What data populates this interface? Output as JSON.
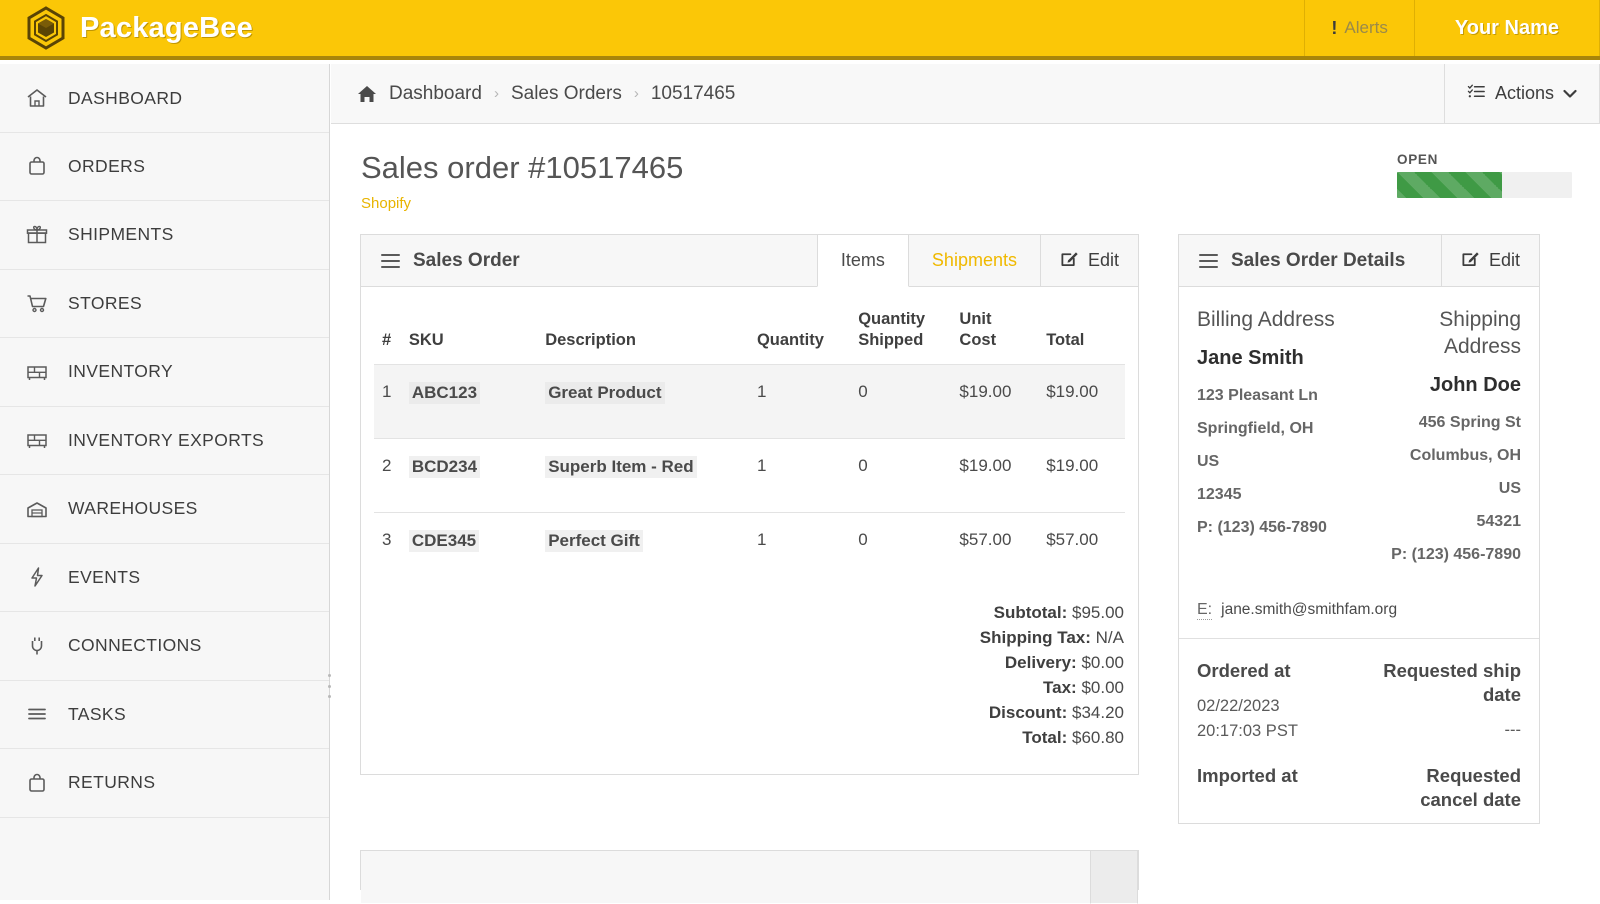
{
  "topbar": {
    "brand": "PackageBee",
    "logo_icon": "hexagon-cube-logo",
    "alerts_label": "Alerts",
    "alerts_icon": "exclamation-icon",
    "user_label": "Your Name"
  },
  "sidebar": {
    "items": [
      {
        "label": "DASHBOARD",
        "icon": "home-icon"
      },
      {
        "label": "ORDERS",
        "icon": "bag-icon"
      },
      {
        "label": "SHIPMENTS",
        "icon": "gift-icon"
      },
      {
        "label": "STORES",
        "icon": "shopping-cart-icon"
      },
      {
        "label": "INVENTORY",
        "icon": "shelf-icon"
      },
      {
        "label": "INVENTORY EXPORTS",
        "icon": "shelf-icon"
      },
      {
        "label": "WAREHOUSES",
        "icon": "warehouse-icon"
      },
      {
        "label": "EVENTS",
        "icon": "lightning-bolt-icon"
      },
      {
        "label": "CONNECTIONS",
        "icon": "plug-icon"
      },
      {
        "label": "TASKS",
        "icon": "list-icon"
      },
      {
        "label": "RETURNS",
        "icon": "bag-icon"
      }
    ]
  },
  "breadcrumb": {
    "home_icon": "home-icon",
    "items": [
      "Dashboard",
      "Sales Orders",
      "10517465"
    ],
    "separator": "›",
    "actions_label": "Actions",
    "actions_icon": "task-list-icon",
    "actions_caret": "chevron-down-icon"
  },
  "page": {
    "title": "Sales order #10517465",
    "source_link": "Shopify",
    "status_label": "OPEN",
    "status_percent": 60,
    "status_color": "#3f9a45"
  },
  "sales_order_card": {
    "title": "Sales Order",
    "menu_icon": "hamburger-icon",
    "tabs": [
      {
        "label": "Items",
        "active": true
      },
      {
        "label": "Shipments",
        "active": false
      }
    ],
    "edit_label": "Edit",
    "edit_icon": "pencil-square-icon",
    "columns": [
      "#",
      "SKU",
      "Description",
      "Quantity",
      "Quantity Shipped",
      "Unit Cost",
      "Total"
    ],
    "rows": [
      {
        "num": "1",
        "sku": "ABC123",
        "description": "Great Product",
        "quantity": "1",
        "quantity_shipped": "0",
        "unit_cost": "$19.00",
        "total": "$19.00",
        "highlighted": true
      },
      {
        "num": "2",
        "sku": "BCD234",
        "description": "Superb Item - Red",
        "quantity": "1",
        "quantity_shipped": "0",
        "unit_cost": "$19.00",
        "total": "$19.00",
        "highlighted": false
      },
      {
        "num": "3",
        "sku": "CDE345",
        "description": "Perfect Gift",
        "quantity": "1",
        "quantity_shipped": "0",
        "unit_cost": "$57.00",
        "total": "$57.00",
        "highlighted": false
      }
    ],
    "totals": [
      {
        "label": "Subtotal:",
        "value": "$95.00"
      },
      {
        "label": "Shipping Tax:",
        "value": "N/A"
      },
      {
        "label": "Delivery:",
        "value": "$0.00"
      },
      {
        "label": "Tax:",
        "value": "$0.00"
      },
      {
        "label": "Discount:",
        "value": "$34.20"
      },
      {
        "label": "Total:",
        "value": "$60.80"
      }
    ]
  },
  "details_card": {
    "title": "Sales Order Details",
    "menu_icon": "hamburger-icon",
    "edit_label": "Edit",
    "edit_icon": "pencil-square-icon",
    "billing": {
      "heading": "Billing Address",
      "name": "Jane Smith",
      "street": "123 Pleasant Ln",
      "city_state": "Springfield, OH",
      "country": "US",
      "postal": "12345",
      "phone": "P: (123) 456-7890"
    },
    "shipping": {
      "heading": "Shipping Address",
      "name": "John Doe",
      "street": "456 Spring St",
      "city_state": "Columbus, OH",
      "country": "US",
      "postal": "54321",
      "phone": "P: (123) 456-7890"
    },
    "email_abbr": "E:",
    "email": "jane.smith@smithfam.org",
    "ordered_at_label": "Ordered at",
    "ordered_at_date": "02/22/2023",
    "ordered_at_time": "20:17:03 PST",
    "requested_ship_label": "Requested ship date",
    "requested_ship_value": "---",
    "imported_at_label": "Imported at",
    "requested_cancel_label": "Requested cancel date"
  }
}
